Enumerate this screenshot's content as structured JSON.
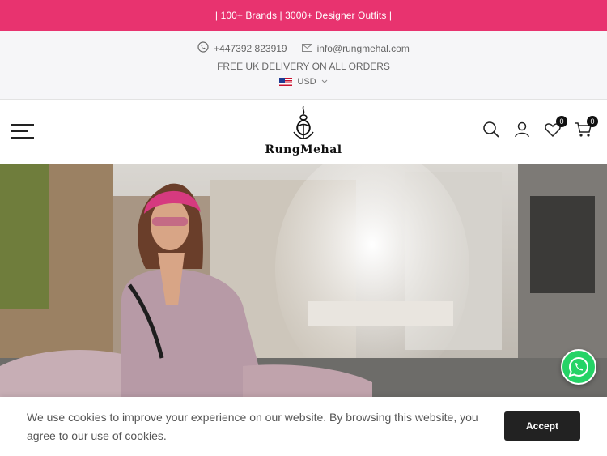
{
  "promo": {
    "text": "| 100+ Brands | 3000+ Designer Outfits |"
  },
  "contact": {
    "phone": "+447392 823919",
    "email": "info@rungmehal.com",
    "delivery": "FREE UK DELIVERY ON ALL ORDERS",
    "currency": "USD"
  },
  "header": {
    "logo_text": "RungMehal",
    "wishlist_count": "0",
    "cart_count": "0",
    "icons": [
      "menu-icon",
      "search-icon",
      "account-icon",
      "heart-icon",
      "cart-icon"
    ]
  },
  "cookie": {
    "message": "We use cookies to improve your experience on our website. By browsing this website, you agree to our use of cookies.",
    "accept_label": "Accept"
  },
  "colors": {
    "promo_bg": "#e8336f",
    "whatsapp": "#25d366",
    "button": "#222222"
  }
}
